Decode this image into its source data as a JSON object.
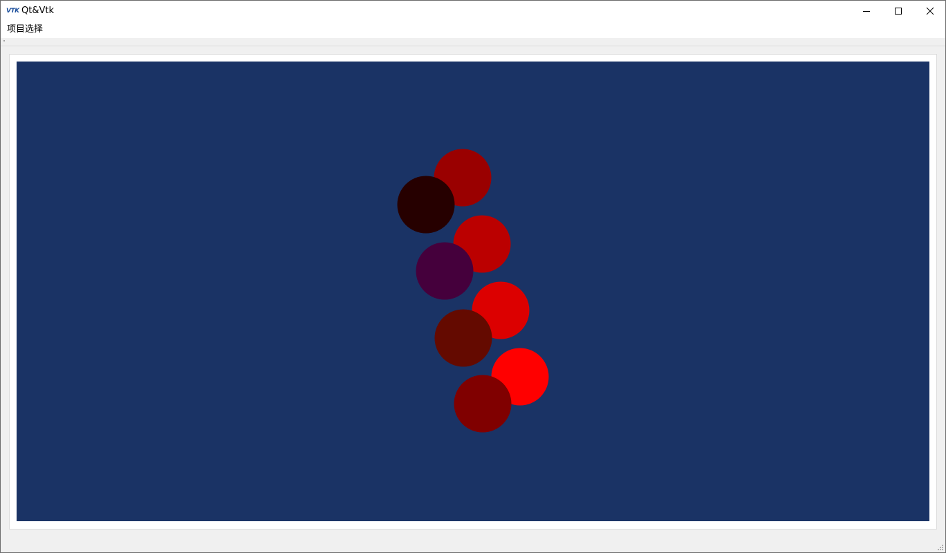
{
  "window": {
    "title": "Qt&Vtk",
    "app_icon_text": "VTK",
    "app_icon": "vtk-logo-icon",
    "controls": {
      "minimize_icon": "minimize-icon",
      "maximize_icon": "maximize-icon",
      "close_icon": "close-icon"
    }
  },
  "menubar": {
    "items": [
      {
        "label": "项目选择"
      }
    ]
  },
  "render_view": {
    "background_color": "#1a3365",
    "spheres": [
      {
        "color": "#9a0000"
      },
      {
        "color": "#260000"
      },
      {
        "color": "#bb0000"
      },
      {
        "color": "#45003c"
      },
      {
        "color": "#dc0000"
      },
      {
        "color": "#640a00"
      },
      {
        "color": "#ff0000"
      },
      {
        "color": "#800000"
      }
    ]
  }
}
